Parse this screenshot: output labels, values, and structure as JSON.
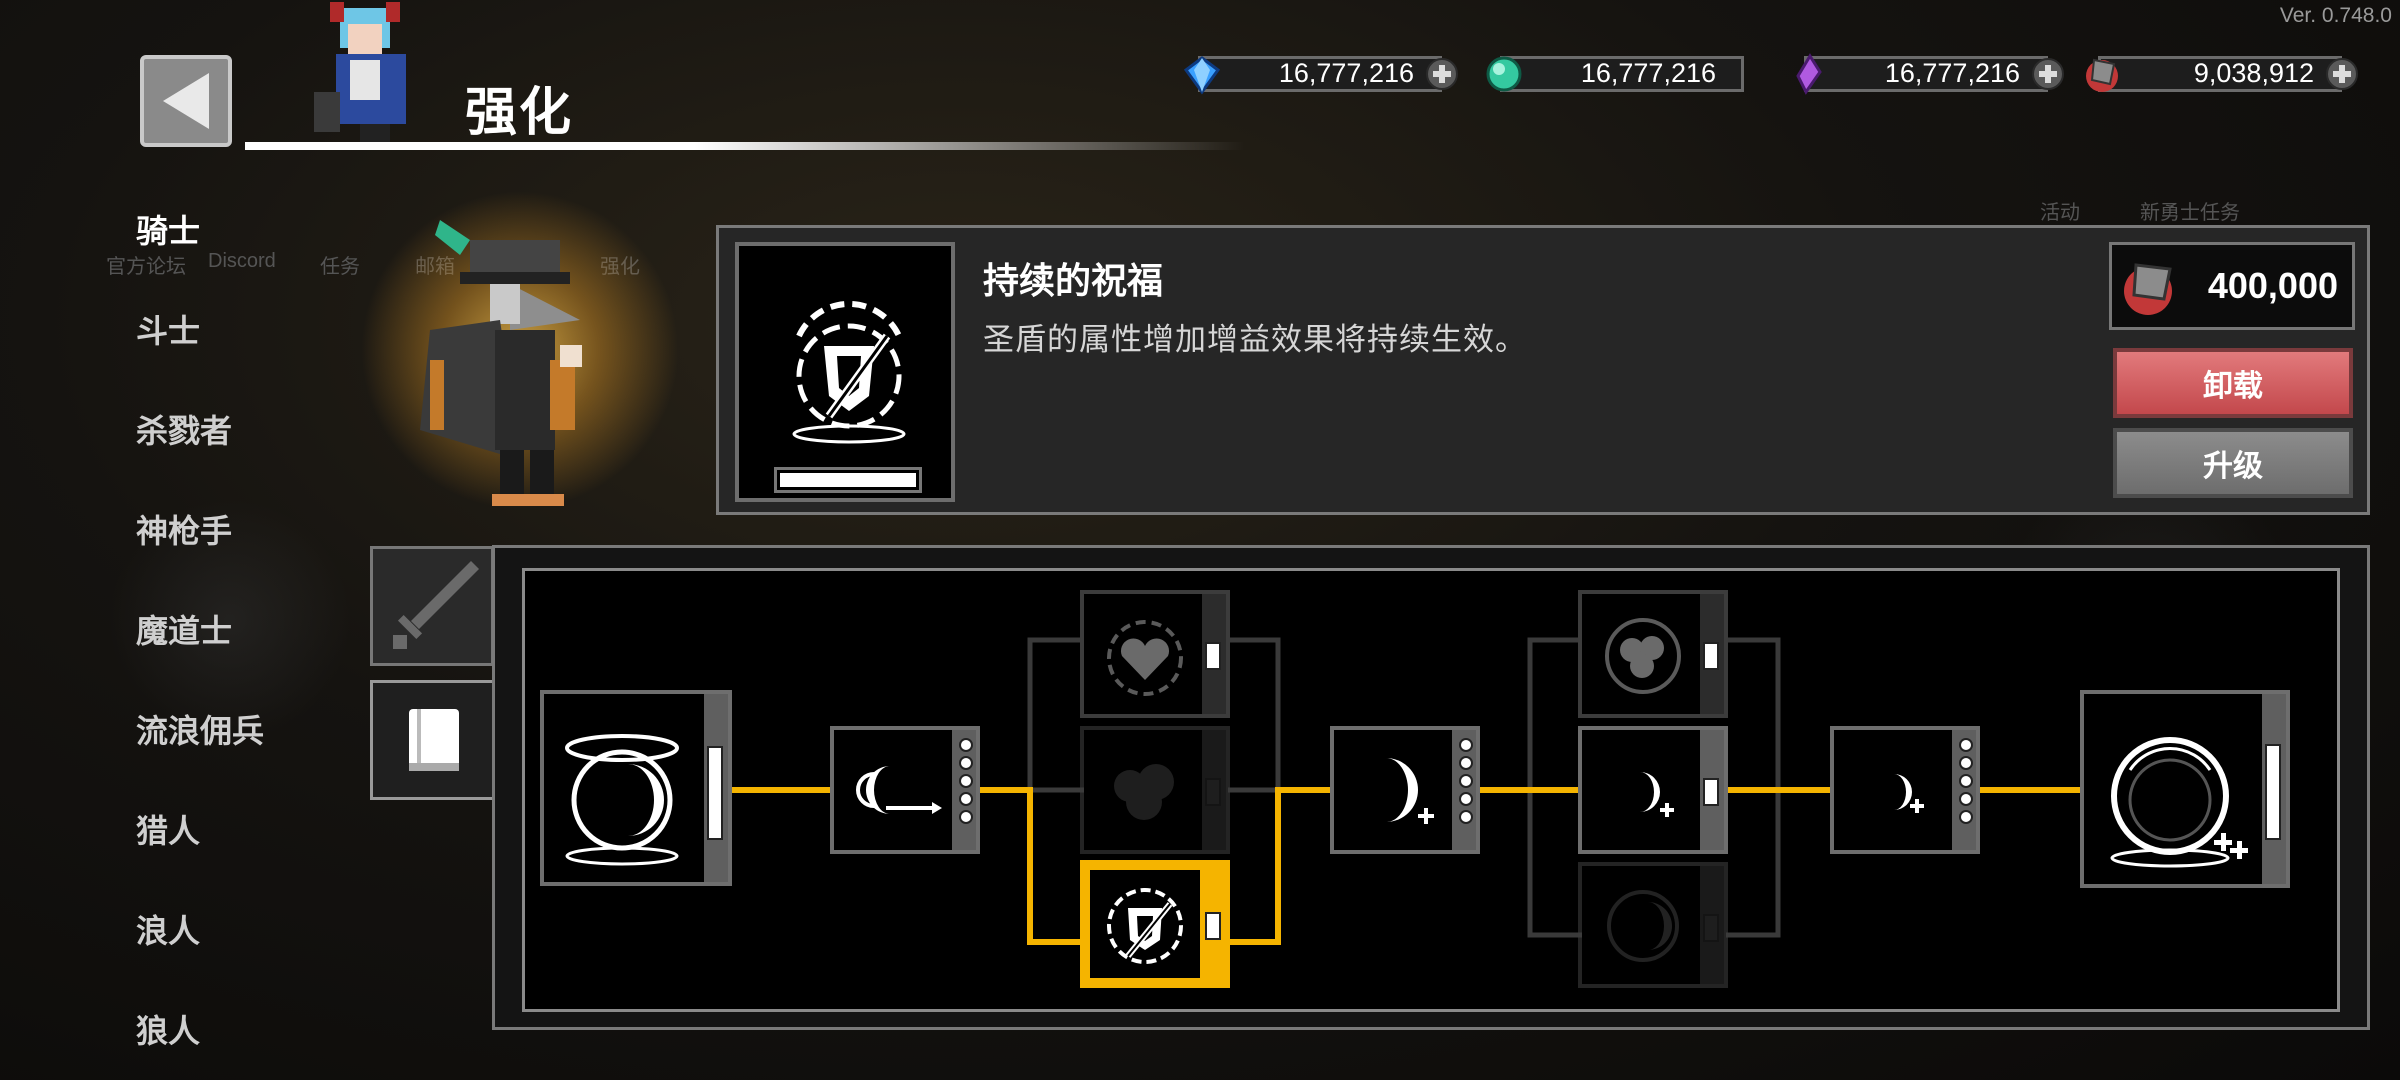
{
  "version": "Ver. 0.748.0",
  "header": {
    "title": "强化",
    "ghost_labels": [
      "官方论坛",
      "Discord",
      "任务",
      "邮箱",
      "强化"
    ],
    "ghost_right": [
      "活动",
      "新勇士任务"
    ]
  },
  "currencies": [
    {
      "name": "gem-blue",
      "value": "16,777,216",
      "color": "#3aa0ff"
    },
    {
      "name": "gem-teal",
      "value": "16,777,216",
      "color": "#34c9a0"
    },
    {
      "name": "gem-purple",
      "value": "16,777,216",
      "color": "#b05ae0"
    },
    {
      "name": "ore-red",
      "value": "9,038,912",
      "color": "#d04040"
    }
  ],
  "sidebar": {
    "items": [
      {
        "label": "骑士",
        "active": true
      },
      {
        "label": "斗士"
      },
      {
        "label": "杀戮者"
      },
      {
        "label": "神枪手"
      },
      {
        "label": "魔道士"
      },
      {
        "label": "流浪佣兵"
      },
      {
        "label": "猎人"
      },
      {
        "label": "浪人"
      },
      {
        "label": "狼人"
      }
    ]
  },
  "detail": {
    "name": "持续的祝福",
    "description": "圣盾的属性增加增益效果将持续生效。",
    "cost": "400,000",
    "unload_label": "卸载",
    "upgrade_label": "升级"
  },
  "tabs": [
    {
      "name": "sword-tab",
      "icon": "sword-icon"
    },
    {
      "name": "book-tab",
      "icon": "book-icon",
      "active": true
    }
  ],
  "tree": {
    "accent": "#f5b400",
    "nodes": [
      "moon-orb",
      "crescent-arrow",
      "heart-shield",
      "cloud-shield",
      "shield-blessing",
      "moon-plus",
      "shield-cluster",
      "moon-plus-small",
      "shield-gloom",
      "moon-plus-tiny",
      "orb-plus-plus"
    ]
  }
}
